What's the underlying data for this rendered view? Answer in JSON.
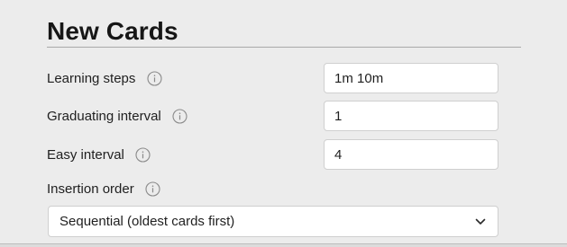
{
  "section": {
    "title": "New Cards"
  },
  "settings": [
    {
      "label": "Learning steps",
      "value": "1m 10m",
      "help_icon": "info-icon"
    },
    {
      "label": "Graduating interval",
      "value": "1",
      "help_icon": "info-icon"
    },
    {
      "label": "Easy interval",
      "value": "4",
      "help_icon": "info-icon"
    }
  ],
  "insertion": {
    "label": "Insertion order",
    "help_icon": "info-icon",
    "selected": "Sequential (oldest cards first)",
    "dropdown_icon": "chevron-down-icon"
  },
  "colors": {
    "background": "#ececec",
    "field_background": "#ffffff",
    "field_border": "#cfcfcf",
    "rule": "#a9a9a9"
  }
}
